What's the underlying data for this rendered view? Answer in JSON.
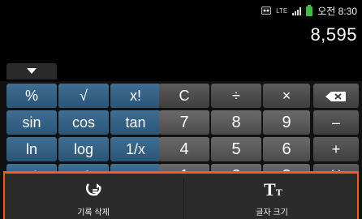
{
  "status_bar": {
    "network": "LTE",
    "time": "오전 8:30",
    "icons": [
      "notification-icon",
      "lte-icon",
      "signal-icon",
      "battery-icon"
    ]
  },
  "display": {
    "value": "8,595"
  },
  "keypad": {
    "row1": [
      "%",
      "√",
      "x!",
      "C",
      "÷",
      "×",
      "⌫"
    ],
    "row2": [
      "sin",
      "cos",
      "tan",
      "7",
      "8",
      "9",
      "–"
    ],
    "row3": [
      "ln",
      "log",
      "1/x",
      "4",
      "5",
      "6",
      "+"
    ],
    "row4": [
      "x²",
      "x³",
      "xʸ",
      "1",
      "2",
      "3",
      "( )"
    ]
  },
  "menu": {
    "items": [
      {
        "label": "기록 삭제",
        "icon": "clear-history-icon"
      },
      {
        "label": "글자 크기",
        "icon": "font-size-icon"
      }
    ]
  },
  "colors": {
    "function_key": "#3a668a",
    "number_key": "#5a5a5a",
    "operator_key": "#4d4d4d",
    "menu_accent": "#ff5a1e"
  }
}
